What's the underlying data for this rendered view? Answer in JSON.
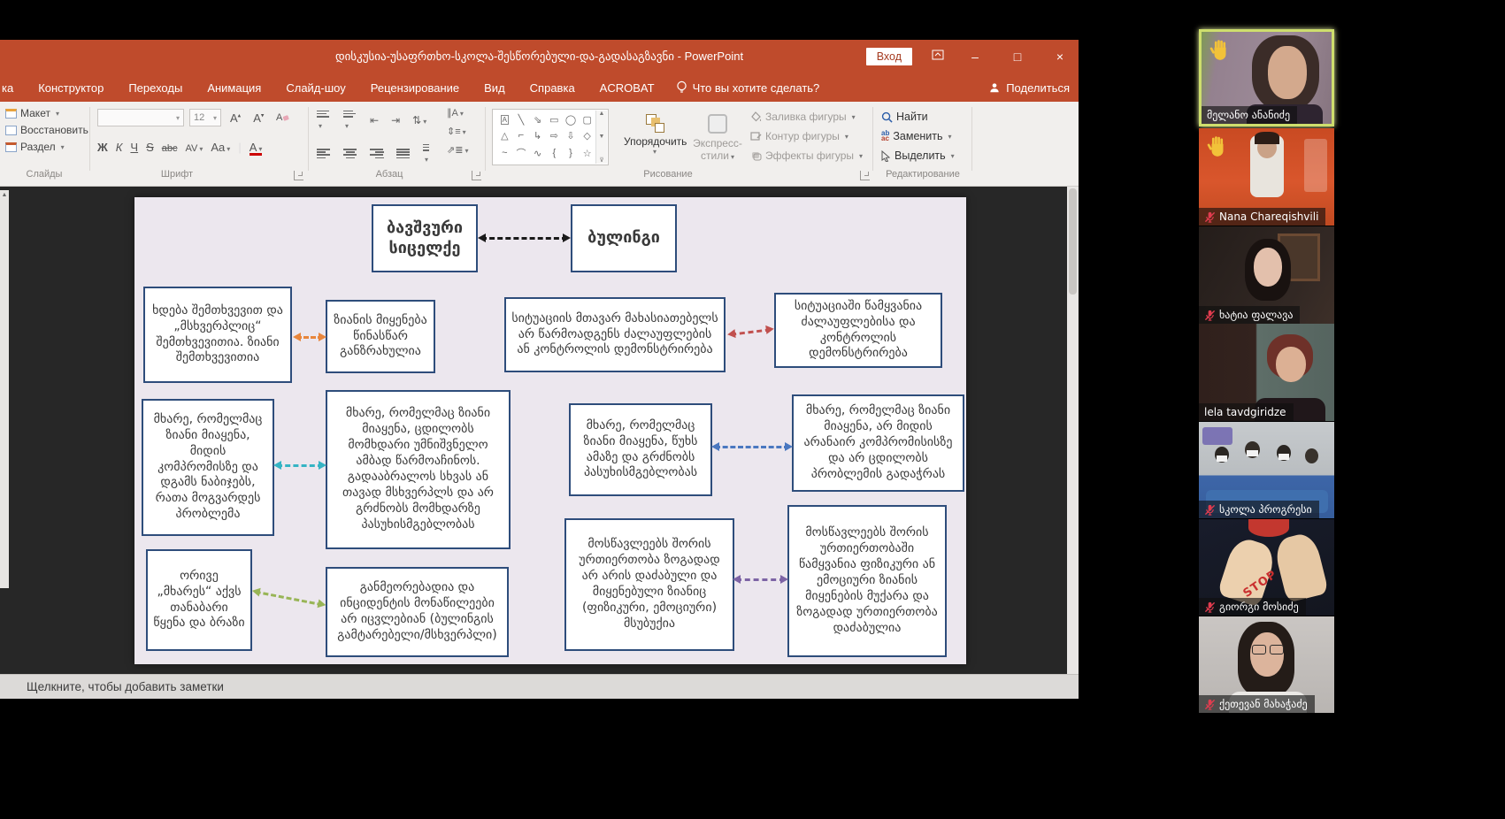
{
  "powerpoint": {
    "title": "დისკუსია-უსაფრთხო-სკოლა-შესწორებული-და-გადასაგზავნი  -  PowerPoint",
    "login_button": "Вход",
    "tabs": [
      "ка",
      "Конструктор",
      "Переходы",
      "Анимация",
      "Слайд-шоу",
      "Рецензирование",
      "Вид",
      "Справка",
      "ACROBAT"
    ],
    "tell_me": "Что вы хотите сделать?",
    "share_label": "Поделиться",
    "slides_group": {
      "label": "Слайды",
      "layout": "Макет",
      "reset": "Восстановить",
      "section": "Раздел"
    },
    "font_group": {
      "label": "Шрифт",
      "font_size": "12",
      "bold": "Ж",
      "italic": "К",
      "underline": "Ч",
      "strike": "S",
      "abc": "abc",
      "char_spacing": "AV",
      "change_case": "Aa",
      "font_color": "A"
    },
    "paragraph_group": {
      "label": "Абзац"
    },
    "drawing_group": {
      "label": "Рисование",
      "arrange": "Упорядочить",
      "quick_styles_1": "Экспресс-",
      "quick_styles_2": "стили",
      "shape_fill": "Заливка фигуры",
      "shape_outline": "Контур фигуры",
      "shape_effects": "Эффекты фигуры",
      "shapes": [
        "A",
        "╲",
        "⇘",
        "▭",
        "◯",
        "▢",
        "△",
        "⌐",
        "↳",
        "⇨",
        "⇩",
        "◇",
        "~",
        "⌒",
        "∿",
        "{",
        "}",
        "☆"
      ]
    },
    "editing_group": {
      "label": "Редактирование",
      "find": "Найти",
      "replace": "Заменить",
      "select": "Выделить"
    },
    "notes_placeholder": "Щелкните, чтобы добавить заметки"
  },
  "slide": {
    "header_left": "ბავშვური სიცელქე",
    "header_right": "ბულინგი",
    "boxes": [
      {
        "text": "ხდება შემთხვევით და „მსხვერპლიც“ შემთხვევითია. ზიანი შემთხვევითია"
      },
      {
        "text": "ზიანის მიყენება წინასწარ განზრახულია"
      },
      {
        "text": "სიტუაციის მთავარ მახასიათებელს არ წარმოადგენს ძალაუფლების ან კონტროლის დემონსტრირება"
      },
      {
        "text": "სიტუაციაში წამყვანია ძალაუფლებისა და კონტროლის დემონსტრირება"
      },
      {
        "text": "მხარე, რომელმაც ზიანი მიაყენა, მიდის კომპრომისზე და დგამს ნაბიჯებს, რათა მოგვარდეს პრობლემა"
      },
      {
        "text": "მხარე, რომელმაც ზიანი მიაყენა, ცდილობს მომხდარი უმნიშვნელო ამბად წარმოაჩინოს. გადააბრალოს სხვას ან თავად მსხვერპლს და არ გრძნობს მომხდარზე პასუხისმგებლობას"
      },
      {
        "text": "მხარე, რომელმაც ზიანი მიაყენა, წუხს ამაზე და გრძნობს პასუხისმგებლობას"
      },
      {
        "text": "მხარე, რომელმაც ზიანი მიაყენა, არ მიდის არანაირ კომპრომისისზე და არ ცდილობს პრობლემის გადაჭრას"
      },
      {
        "text": "ორივე „მხარეს“ აქვს თანაბარი წყენა და ბრაზი"
      },
      {
        "text": "განმეორებადია და ინციდენტის მონაწილეები არ იცვლებიან (ბულინგის გამტარებელი/მსხვერპლი)"
      },
      {
        "text": "მოსწავლეებს შორის ურთიერთობა ზოგადად არ არის დაძაბული და მიყენებული ზიანიც (ფიზიკური, ემოციური) მსუბუქია"
      },
      {
        "text": "მოსწავლეებს შორის ურთიერთობაში წამყვანია ფიზიკური ან ემოციური ზიანის მიყენების მუქარა და ზოგადად ურთიერთობა დაძაბულია"
      }
    ],
    "connectors": [
      {
        "color": "#1a1a1a"
      },
      {
        "color": "#e8863c"
      },
      {
        "color": "#c1504e"
      },
      {
        "color": "#35b4c4"
      },
      {
        "color": "#4a78c0"
      },
      {
        "color": "#98b556"
      },
      {
        "color": "#7d64a5"
      }
    ]
  },
  "participants": [
    {
      "name": "მელანო ანანიძე"
    },
    {
      "name": "Nana Chareqishvili"
    },
    {
      "name": "ხატია ფალავა"
    },
    {
      "name": "lela tavdgiridze"
    },
    {
      "name": "სკოლა პროგრესი"
    },
    {
      "name": "გიორგი მოსიძე",
      "overlay_text": "STOP"
    },
    {
      "name": "ქეთევან მახაჭაძე"
    }
  ]
}
